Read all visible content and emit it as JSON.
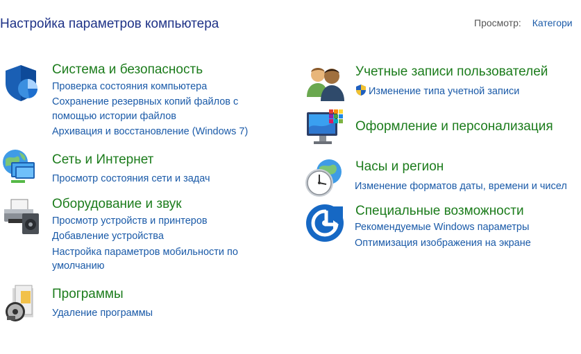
{
  "header": {
    "title": "Настройка параметров компьютера",
    "view_label": "Просмотр:",
    "view_value": "Категори"
  },
  "left": [
    {
      "title": "Система и безопасность",
      "links": [
        "Проверка состояния компьютера",
        "Сохранение резервных копий файлов с",
        "помощью истории файлов",
        "Архивация и восстановление (Windows 7)"
      ]
    },
    {
      "title": "Сеть и Интернет",
      "links": [
        "Просмотр состояния сети и задач"
      ]
    },
    {
      "title": "Оборудование и звук",
      "links": [
        "Просмотр устройств и принтеров",
        "Добавление устройства",
        "Настройка параметров мобильности по",
        "умолчанию"
      ]
    },
    {
      "title": "Программы",
      "links": [
        "Удаление программы"
      ]
    }
  ],
  "right": [
    {
      "title": "Учетные записи пользователей",
      "links": [
        "Изменение типа учетной записи"
      ]
    },
    {
      "title": "Оформление и персонализация",
      "links": []
    },
    {
      "title": "Часы и регион",
      "links": [
        "Изменение форматов даты, времени и чисел"
      ]
    },
    {
      "title": "Специальные возможности",
      "links": [
        "Рекомендуемые Windows параметры",
        "Оптимизация изображения на экране"
      ]
    }
  ],
  "icons": {
    "system": "shield-icon",
    "network": "globe-network-icon",
    "hardware": "printer-icon",
    "programs": "programs-box-icon",
    "accounts": "users-icon",
    "appearance": "monitor-palette-icon",
    "clock": "clock-globe-icon",
    "access": "ease-of-access-icon",
    "uac": "uac-shield-icon"
  }
}
